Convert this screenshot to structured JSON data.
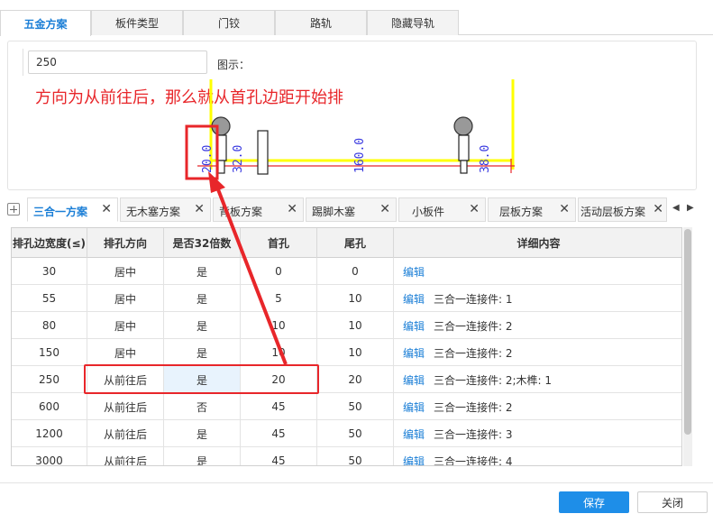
{
  "top_tabs": [
    "五金方案",
    "板件类型",
    "门铰",
    "路轨",
    "隐藏导轨"
  ],
  "panel": {
    "input_value": "250",
    "diagram_label": "图示：",
    "annotation": "方向为从前往后，那么就从首孔边距开始排",
    "dims": [
      "20.0",
      "32.0",
      "160.0",
      "38.0"
    ]
  },
  "sub_tabs": [
    "三合一方案",
    "无木塞方案",
    "背板方案",
    "踢脚木塞",
    "小板件",
    "层板方案",
    "活动层板方案"
  ],
  "close_glyph": "✕",
  "grid": {
    "headers": [
      "排孔边宽度(≤)",
      "排孔方向",
      "是否32倍数",
      "首孔",
      "尾孔",
      "详细内容"
    ],
    "edit_label": "编辑",
    "rows": [
      {
        "width": "30",
        "direction": "居中",
        "mult32": "是",
        "first": "0",
        "last": "0",
        "detail": ""
      },
      {
        "width": "55",
        "direction": "居中",
        "mult32": "是",
        "first": "5",
        "last": "10",
        "detail": "三合一连接件: 1"
      },
      {
        "width": "80",
        "direction": "居中",
        "mult32": "是",
        "first": "10",
        "last": "10",
        "detail": "三合一连接件: 2"
      },
      {
        "width": "150",
        "direction": "居中",
        "mult32": "是",
        "first": "10",
        "last": "10",
        "detail": "三合一连接件: 2"
      },
      {
        "width": "250",
        "direction": "从前往后",
        "mult32": "是",
        "first": "20",
        "last": "20",
        "detail": "三合一连接件: 2;木榫: 1"
      },
      {
        "width": "600",
        "direction": "从前往后",
        "mult32": "否",
        "first": "45",
        "last": "50",
        "detail": "三合一连接件: 2"
      },
      {
        "width": "1200",
        "direction": "从前往后",
        "mult32": "是",
        "first": "45",
        "last": "50",
        "detail": "三合一连接件: 3"
      },
      {
        "width": "3000",
        "direction": "从前往后",
        "mult32": "是",
        "first": "45",
        "last": "50",
        "detail": "三合一连接件: 4"
      }
    ]
  },
  "buttons": {
    "save": "保存",
    "close": "关闭"
  },
  "colors": {
    "accent": "#1a7ed6",
    "annotation": "#e8262a",
    "yellow": "#ffff00",
    "dim_text": "#3a3ae0"
  }
}
